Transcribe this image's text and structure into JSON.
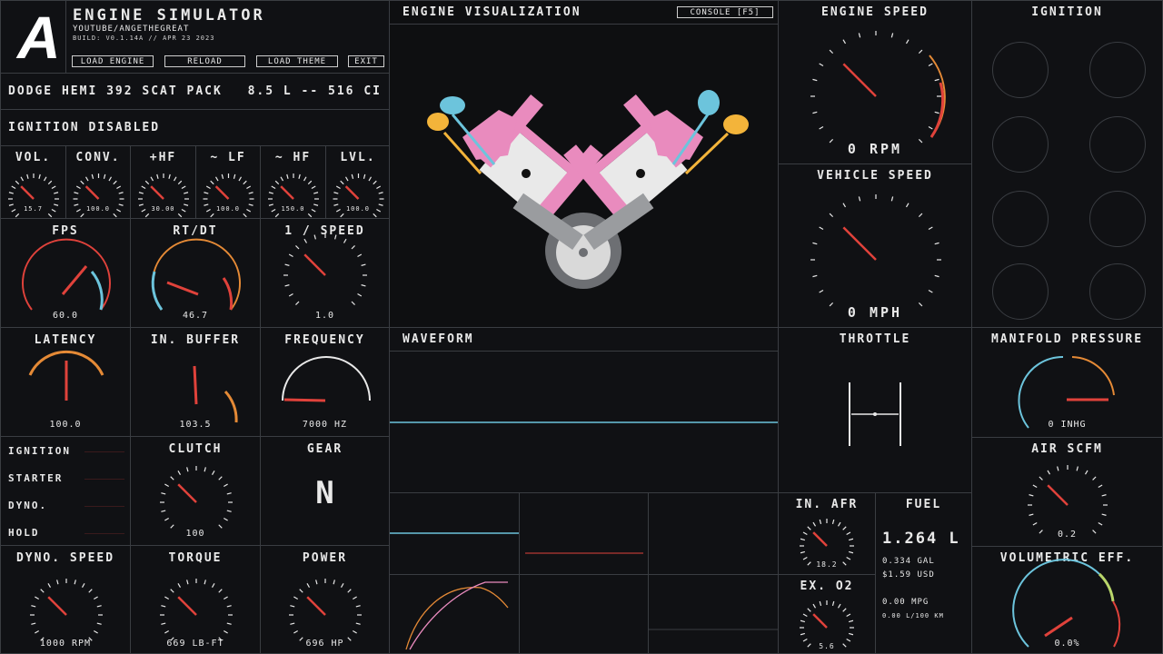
{
  "app": {
    "logo_letter": "A",
    "title": "ENGINE SIMULATOR",
    "subtitle": "YOUTUBE/ANGETHEGREAT",
    "build": "BUILD: V0.1.14A // APR 23 2023",
    "buttons": [
      "LOAD ENGINE",
      "RELOAD",
      "LOAD THEME",
      "EXIT"
    ]
  },
  "engine": {
    "name": "DODGE HEMI 392 SCAT PACK",
    "displacement": "8.5 L -- 516 CI"
  },
  "status": {
    "ignition_text": "IGNITION DISABLED"
  },
  "audio_gauges": [
    {
      "label": "VOL.",
      "value": "15.7"
    },
    {
      "label": "CONV.",
      "value": "100.0"
    },
    {
      "label": "+HF",
      "value": "30.00"
    },
    {
      "label": "~ LF",
      "value": "100.0"
    },
    {
      "label": "~ HF",
      "value": "150.0"
    },
    {
      "label": "LVL.",
      "value": "100.0"
    }
  ],
  "perf_gauges": [
    {
      "label": "FPS",
      "value": "60.0"
    },
    {
      "label": "RT/DT",
      "value": "46.7"
    },
    {
      "label": "1 / SPEED",
      "value": "1.0"
    }
  ],
  "row3_gauges": [
    {
      "label": "LATENCY",
      "value": "100.0"
    },
    {
      "label": "IN. BUFFER",
      "value": "103.5"
    },
    {
      "label": "FREQUENCY",
      "value": "7000 HZ"
    }
  ],
  "indicators": [
    "IGNITION",
    "STARTER",
    "DYNO.",
    "HOLD"
  ],
  "clutch": {
    "label": "CLUTCH",
    "value": "100"
  },
  "gear": {
    "label": "GEAR",
    "value": "N"
  },
  "bottom_gauges": [
    {
      "label": "DYNO. SPEED",
      "value": "1000 RPM"
    },
    {
      "label": "TORQUE",
      "value": "669 LB-FT"
    },
    {
      "label": "POWER",
      "value": "696 HP"
    }
  ],
  "visualization": {
    "title": "ENGINE VISUALIZATION",
    "console_button": "CONSOLE [F5]"
  },
  "waveform": {
    "title": "WAVEFORM"
  },
  "engine_speed": {
    "title": "ENGINE SPEED",
    "value": "0 RPM"
  },
  "vehicle_speed": {
    "title": "VEHICLE SPEED",
    "value": "0 MPH"
  },
  "throttle": {
    "title": "THROTTLE"
  },
  "ignition_panel": {
    "title": "IGNITION"
  },
  "manifold": {
    "title": "MANIFOLD PRESSURE",
    "value": "0 INHG"
  },
  "air_scfm": {
    "title": "AIR SCFM",
    "value": "0.2"
  },
  "in_afr": {
    "title": "IN. AFR",
    "value": "18.2"
  },
  "ex_o2": {
    "title": "EX. O2",
    "value": "5.6"
  },
  "fuel": {
    "title": "FUEL",
    "liters": "1.264 L",
    "gallons": "0.334 GAL",
    "cost": "$1.59 USD",
    "mpg": "0.00 MPG",
    "l_per_100": "0.00 L/100 KM"
  },
  "vol_eff": {
    "title": "VOLUMETRIC EFF.",
    "value": "0.0%"
  },
  "colors": {
    "accent_red": "#e0423b",
    "accent_blue": "#6cc4dc",
    "accent_orange": "#e58a36",
    "piston_pink": "#e98bbe",
    "cam_yellow": "#f3b43a"
  }
}
